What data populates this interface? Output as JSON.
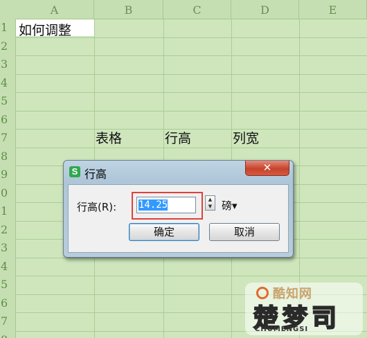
{
  "sheet": {
    "columns": [
      "A",
      "B",
      "C",
      "D",
      "E"
    ],
    "rows": [
      "1",
      "2",
      "3",
      "4",
      "5",
      "6",
      "7",
      "8",
      "9",
      "0",
      "1",
      "2",
      "3",
      "4",
      "5",
      "6",
      "7",
      "8"
    ],
    "cells": {
      "A1": "如何调整",
      "B7": "表格",
      "C7": "行高",
      "D7": "列宽"
    }
  },
  "dialog": {
    "title": "行高",
    "logo_letter": "S",
    "close_glyph": "✕",
    "field_label": "行高(R):",
    "field_value": "14.25",
    "spin_up": "▲",
    "spin_down": "▼",
    "unit_label": "磅▾",
    "ok_label": "确定",
    "cancel_label": "取消"
  },
  "watermark": {
    "top_text": "酷知网",
    "big_text": "楚梦司",
    "sub_text": "CHUMENGSI"
  },
  "colors": {
    "sheet_bg": "#cfe6bd",
    "gridline": "#a9cc93",
    "highlight_border": "#e0403a",
    "close_button": "#c7432c"
  }
}
